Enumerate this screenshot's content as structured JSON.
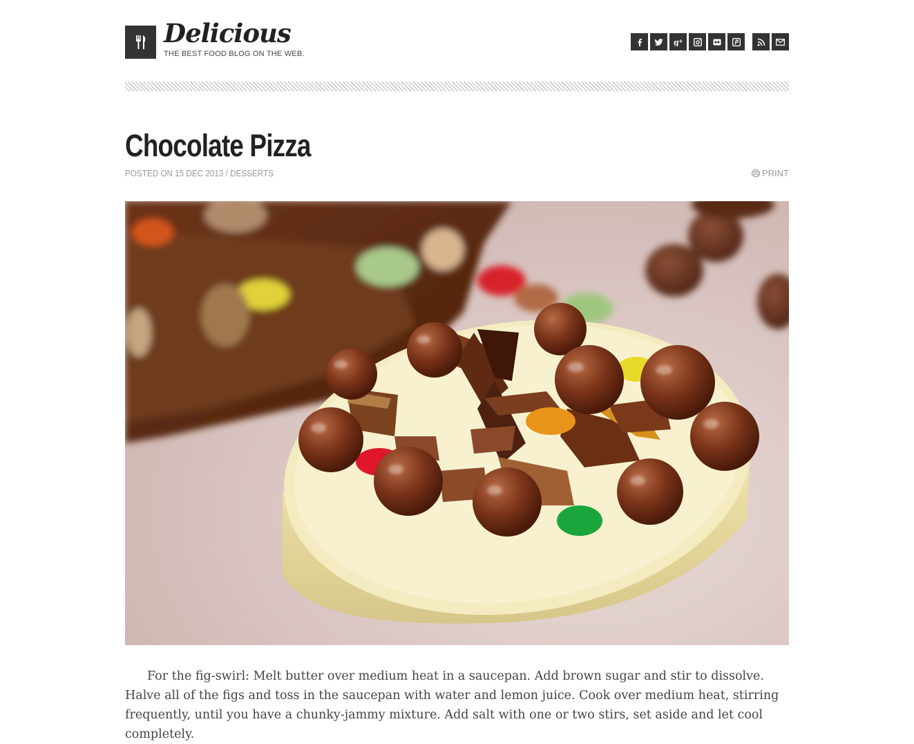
{
  "header": {
    "logo_icon": "fork-knife-icon",
    "site_title": "Delicious",
    "tagline": "THE BEST FOOD BLOG ON THE WEB.",
    "social": [
      {
        "name": "facebook-icon",
        "glyph": "f"
      },
      {
        "name": "twitter-icon",
        "glyph": "t"
      },
      {
        "name": "google-plus-icon",
        "glyph": "g+"
      },
      {
        "name": "instagram-icon",
        "glyph": "ig"
      },
      {
        "name": "flickr-icon",
        "glyph": "fl"
      },
      {
        "name": "pinterest-icon",
        "glyph": "p"
      },
      {
        "name": "rss-icon",
        "glyph": "rss"
      },
      {
        "name": "email-icon",
        "glyph": "mail"
      }
    ]
  },
  "post": {
    "title": "Chocolate Pizza",
    "meta_prefix": "POSTED ON 15 DEC 2013 / ",
    "category": "DESSERTS",
    "print_label": "PRINT",
    "print_icon": "printer-icon",
    "image_alt": "chocolate pizza photo",
    "body": "For the fig-swirl: Melt butter over medium heat in a saucepan. Add brown sugar and stir to dissolve. Halve all of the figs and toss in the saucepan with water and lemon juice. Cook over medium heat, stirring frequently, until you have a chunky-jammy mixture. Add salt with one or two stirs, set aside and let cool completely."
  },
  "colors": {
    "dark": "#333333",
    "meta": "#999999",
    "stripe": "#c9c9c9"
  }
}
